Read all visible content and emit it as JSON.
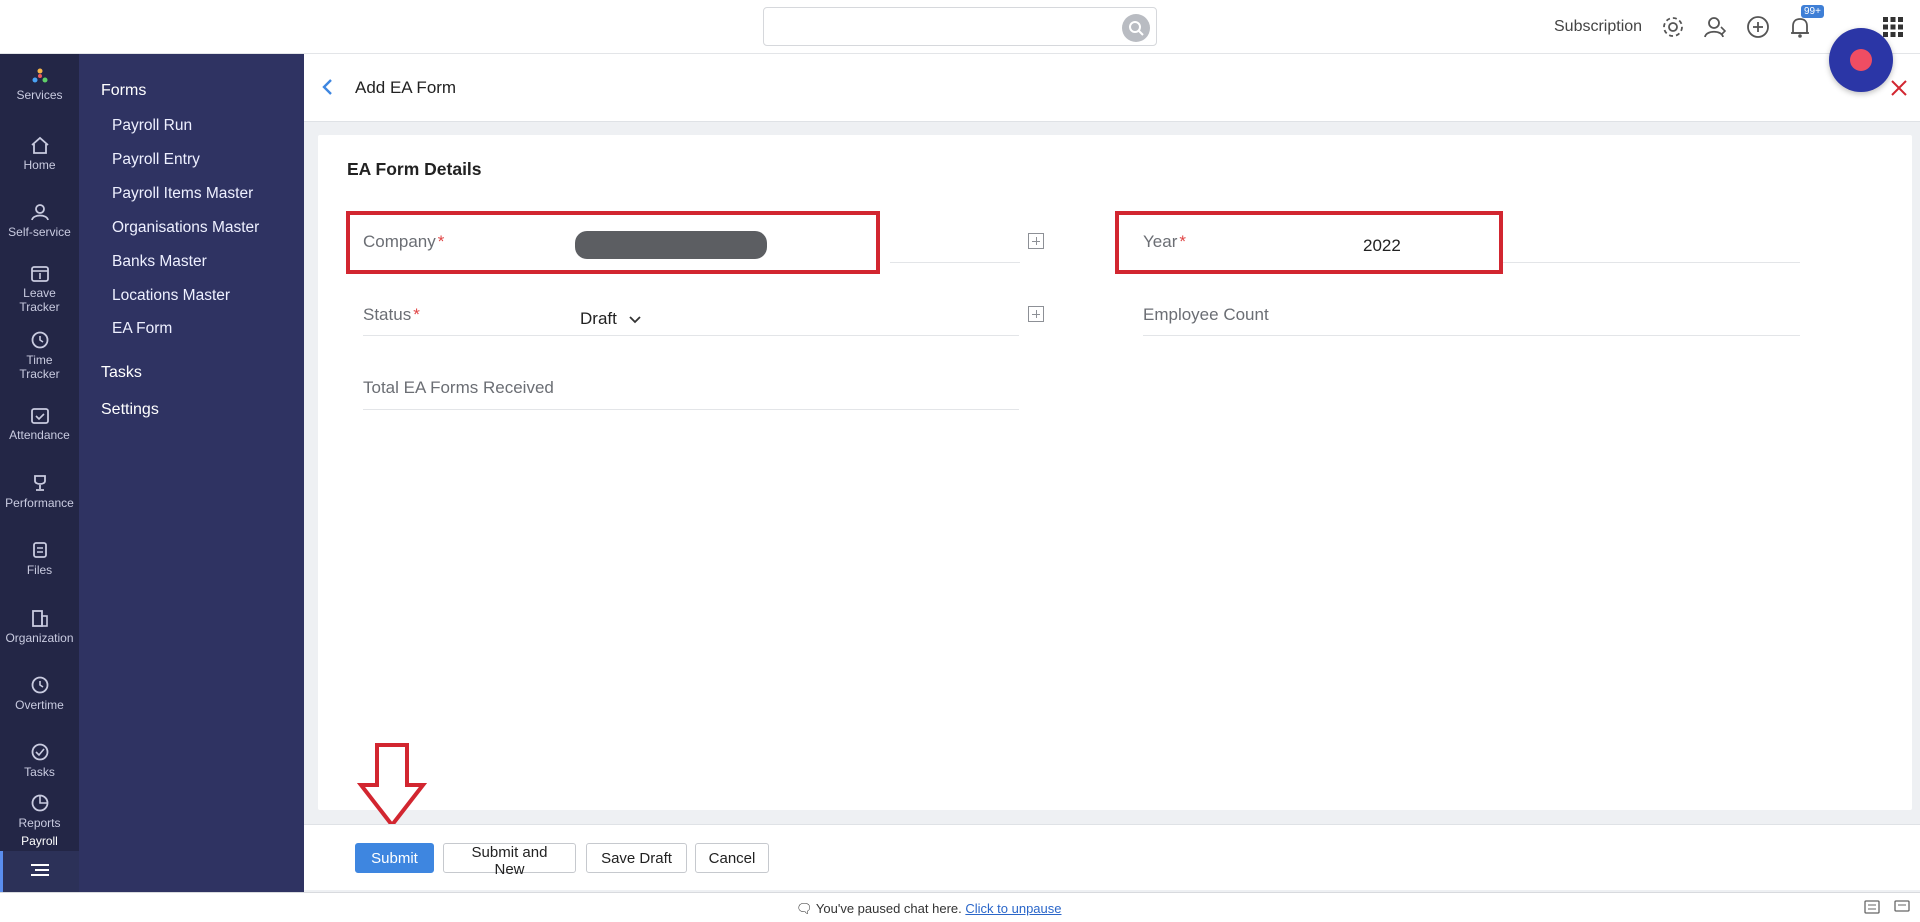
{
  "top": {
    "search_placeholder": "",
    "subscription": "Subscription",
    "notif_badge": "99+"
  },
  "rail": {
    "items": [
      {
        "label": "Services",
        "icon": "services-icon"
      },
      {
        "label": "Home",
        "icon": "home-icon"
      },
      {
        "label": "Self-service",
        "icon": "user-icon"
      },
      {
        "label": "Leave Tracker",
        "icon": "calendar-icon"
      },
      {
        "label": "Time Tracker",
        "icon": "clock-icon"
      },
      {
        "label": "Attendance",
        "icon": "calendar-check-icon"
      },
      {
        "label": "Performance",
        "icon": "trophy-icon"
      },
      {
        "label": "Files",
        "icon": "files-icon"
      },
      {
        "label": "Organization",
        "icon": "building-icon"
      },
      {
        "label": "Overtime",
        "icon": "clock-icon"
      },
      {
        "label": "Tasks",
        "icon": "check-circle-icon"
      },
      {
        "label": "Reports",
        "icon": "pie-chart-icon"
      },
      {
        "label": "Payroll",
        "icon": "payroll-icon"
      }
    ]
  },
  "menu": {
    "forms_label": "Forms",
    "items": [
      "Payroll Run",
      "Payroll Entry",
      "Payroll Items Master",
      "Organisations Master",
      "Banks Master",
      "Locations Master",
      "EA Form"
    ],
    "tasks_label": "Tasks",
    "settings_label": "Settings"
  },
  "page": {
    "title": "Add EA Form",
    "section_title": "EA Form Details"
  },
  "form": {
    "company_label": "Company",
    "company_required": "*",
    "year_label": "Year",
    "year_required": "*",
    "year_value": "2022",
    "status_label": "Status",
    "status_required": "*",
    "status_value": "Draft",
    "employee_count_label": "Employee Count",
    "total_ea_label": "Total EA Forms Received"
  },
  "buttons": {
    "submit": "Submit",
    "submit_and_new": "Submit and New",
    "save_draft": "Save Draft",
    "cancel": "Cancel"
  },
  "status_bar": {
    "text": "You've paused chat here.",
    "link": "Click to unpause"
  },
  "colors": {
    "rail_bg": "#232646",
    "menu_bg": "#2f3362",
    "primary": "#3e86e0",
    "highlight": "#d22630"
  }
}
